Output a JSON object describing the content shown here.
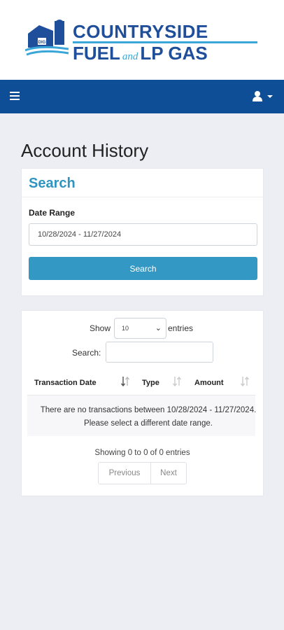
{
  "brand": {
    "line1": "COUNTRYSIDE",
    "line2_a": "FUEL",
    "line2_and": "and",
    "line2_b": "LP GAS",
    "mark_text": "DIG",
    "primary_color": "#1f4e9a",
    "accent_color": "#3aa6d8"
  },
  "navbar": {
    "color": "#0d4e96",
    "menu_icon": "hamburger-icon",
    "user_icon": "user-icon"
  },
  "page": {
    "title": "Account History"
  },
  "search_card": {
    "heading": "Search",
    "date_range_label": "Date Range",
    "date_range_value": "10/28/2024 - 11/27/2024",
    "search_button": "Search"
  },
  "table_card": {
    "show_label": "Show",
    "entries_label": "entries",
    "length_value": "10",
    "filter_label": "Search:",
    "filter_value": "",
    "columns": [
      "Transaction Date",
      "Type",
      "Amount"
    ],
    "empty_message": "There are no transactions between 10/28/2024 - 11/27/2024. Please select a different date range.",
    "info": "Showing 0 to 0 of 0 entries",
    "pagination": {
      "previous": "Previous",
      "next": "Next"
    }
  }
}
